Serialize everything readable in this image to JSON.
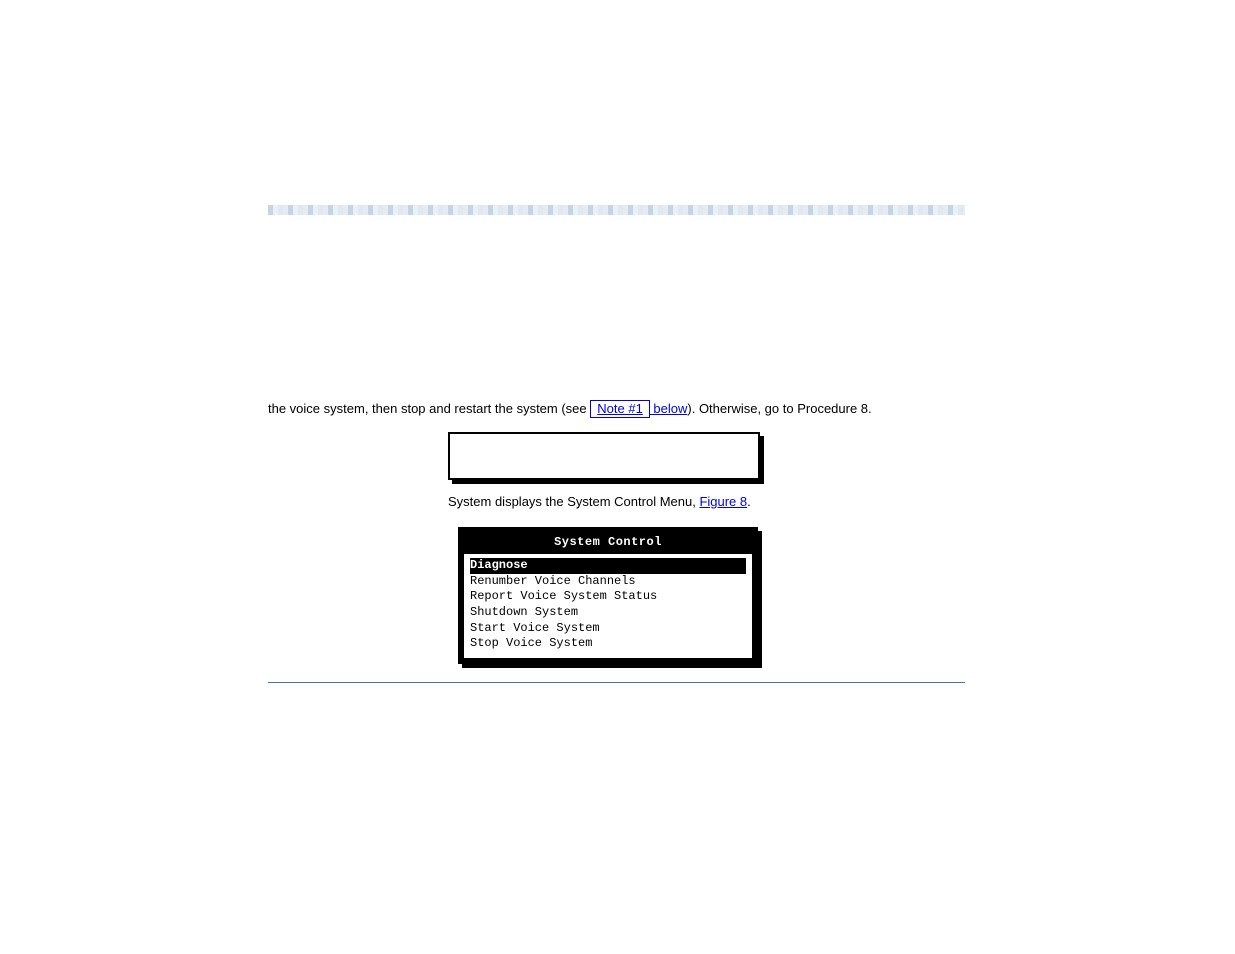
{
  "paragraph": {
    "pre": "the voice system, then stop and restart the system (see ",
    "link_box": "Note #1",
    "link_after": " below",
    "post": "). Otherwise, go to Procedure 8."
  },
  "console_placeholder": "",
  "ref": {
    "text": "System displays the System Control Menu, ",
    "link": "Figure 8",
    "suffix": "."
  },
  "terminal": {
    "title": "System Control",
    "items": [
      "Diagnose",
      "Renumber Voice Channels",
      "Report Voice System Status",
      "Shutdown System",
      "Start Voice System",
      "Stop Voice System"
    ],
    "selected_index": 0
  }
}
